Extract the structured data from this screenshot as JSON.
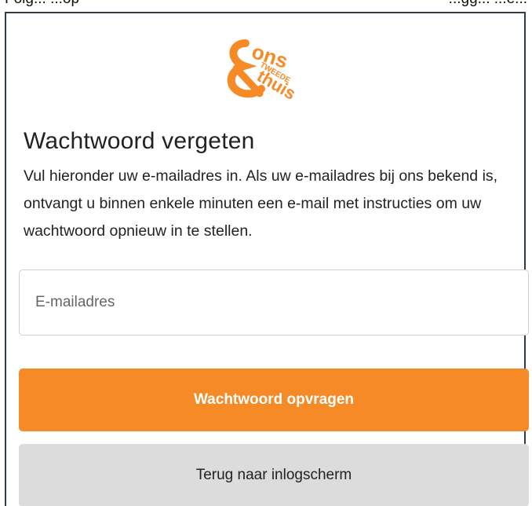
{
  "top_fragment": {
    "left_text": "Folg... ...op",
    "right_text": "...gg... ...e..."
  },
  "logo": {
    "brand_text_ons": "ons",
    "brand_text_tweede": "TWEEDE",
    "brand_text_thuis": "thuis",
    "color": "#f58a26"
  },
  "form": {
    "title": "Wachtwoord vergeten",
    "description": "Vul hieronder uw e-mailadres in. Als uw e-mailadres bij ons bekend is, ontvangt u binnen enkele minuten een e-mail met instructies om uw wachtwoord opnieuw in te stellen.",
    "email_placeholder": "E-mailadres",
    "email_value": "",
    "submit_label": "Wachtwoord opvragen",
    "back_label": "Terug naar inlogscherm"
  },
  "colors": {
    "accent": "#f58a26",
    "secondary_button": "#dcdcdc",
    "panel_border": "#2d3c4e"
  }
}
